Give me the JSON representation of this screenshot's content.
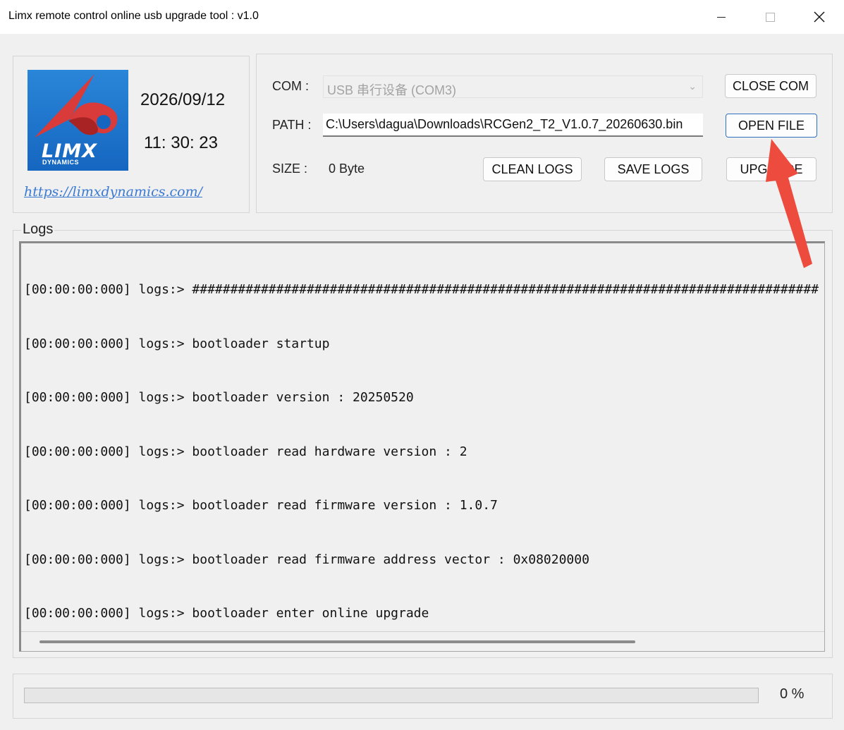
{
  "window": {
    "title": "Limx remote control online usb upgrade tool : v1.0"
  },
  "brand": {
    "logo_text": "LIMX",
    "logo_subtext": "DYNAMICS",
    "date": "2026/09/12",
    "time": "11: 30: 23",
    "link": "https://limxdynamics.com/",
    "colors": {
      "logo_blue": "#1a72cc",
      "logo_red": "#d93a3a",
      "link": "#3a7ad3"
    }
  },
  "controls": {
    "com_label": "COM :",
    "com_value": "USB 串行设备 (COM3)",
    "path_label": "PATH :",
    "path_value": "C:\\Users\\dagua\\Downloads\\RCGen2_T2_V1.0.7_20260630.bin",
    "size_label": "SIZE :",
    "size_value": "0 Byte",
    "close_com_label": "CLOSE COM",
    "open_file_label": "OPEN FILE",
    "clean_logs_label": "CLEAN LOGS",
    "save_logs_label": "SAVE LOGS",
    "upgrade_label": "UPGRADE"
  },
  "logs": {
    "title": "Logs",
    "lines": [
      "[00:00:00:000] logs:> ##################################################################################",
      "[00:00:00:000] logs:> bootloader startup",
      "[00:00:00:000] logs:> bootloader version : 20250520",
      "[00:00:00:000] logs:> bootloader read hardware version : 2",
      "[00:00:00:000] logs:> bootloader read firmware version : 1.0.7",
      "[00:00:00:000] logs:> bootloader read firmware address vector : 0x08020000",
      "[00:00:00:000] logs:> bootloader enter online upgrade"
    ]
  },
  "progress": {
    "percent": 0,
    "label": "0 %",
    "colors": {
      "fill": "#06b025"
    }
  },
  "annotation": {
    "icon": "red-arrow-icon",
    "color": "#ee4b3f"
  }
}
